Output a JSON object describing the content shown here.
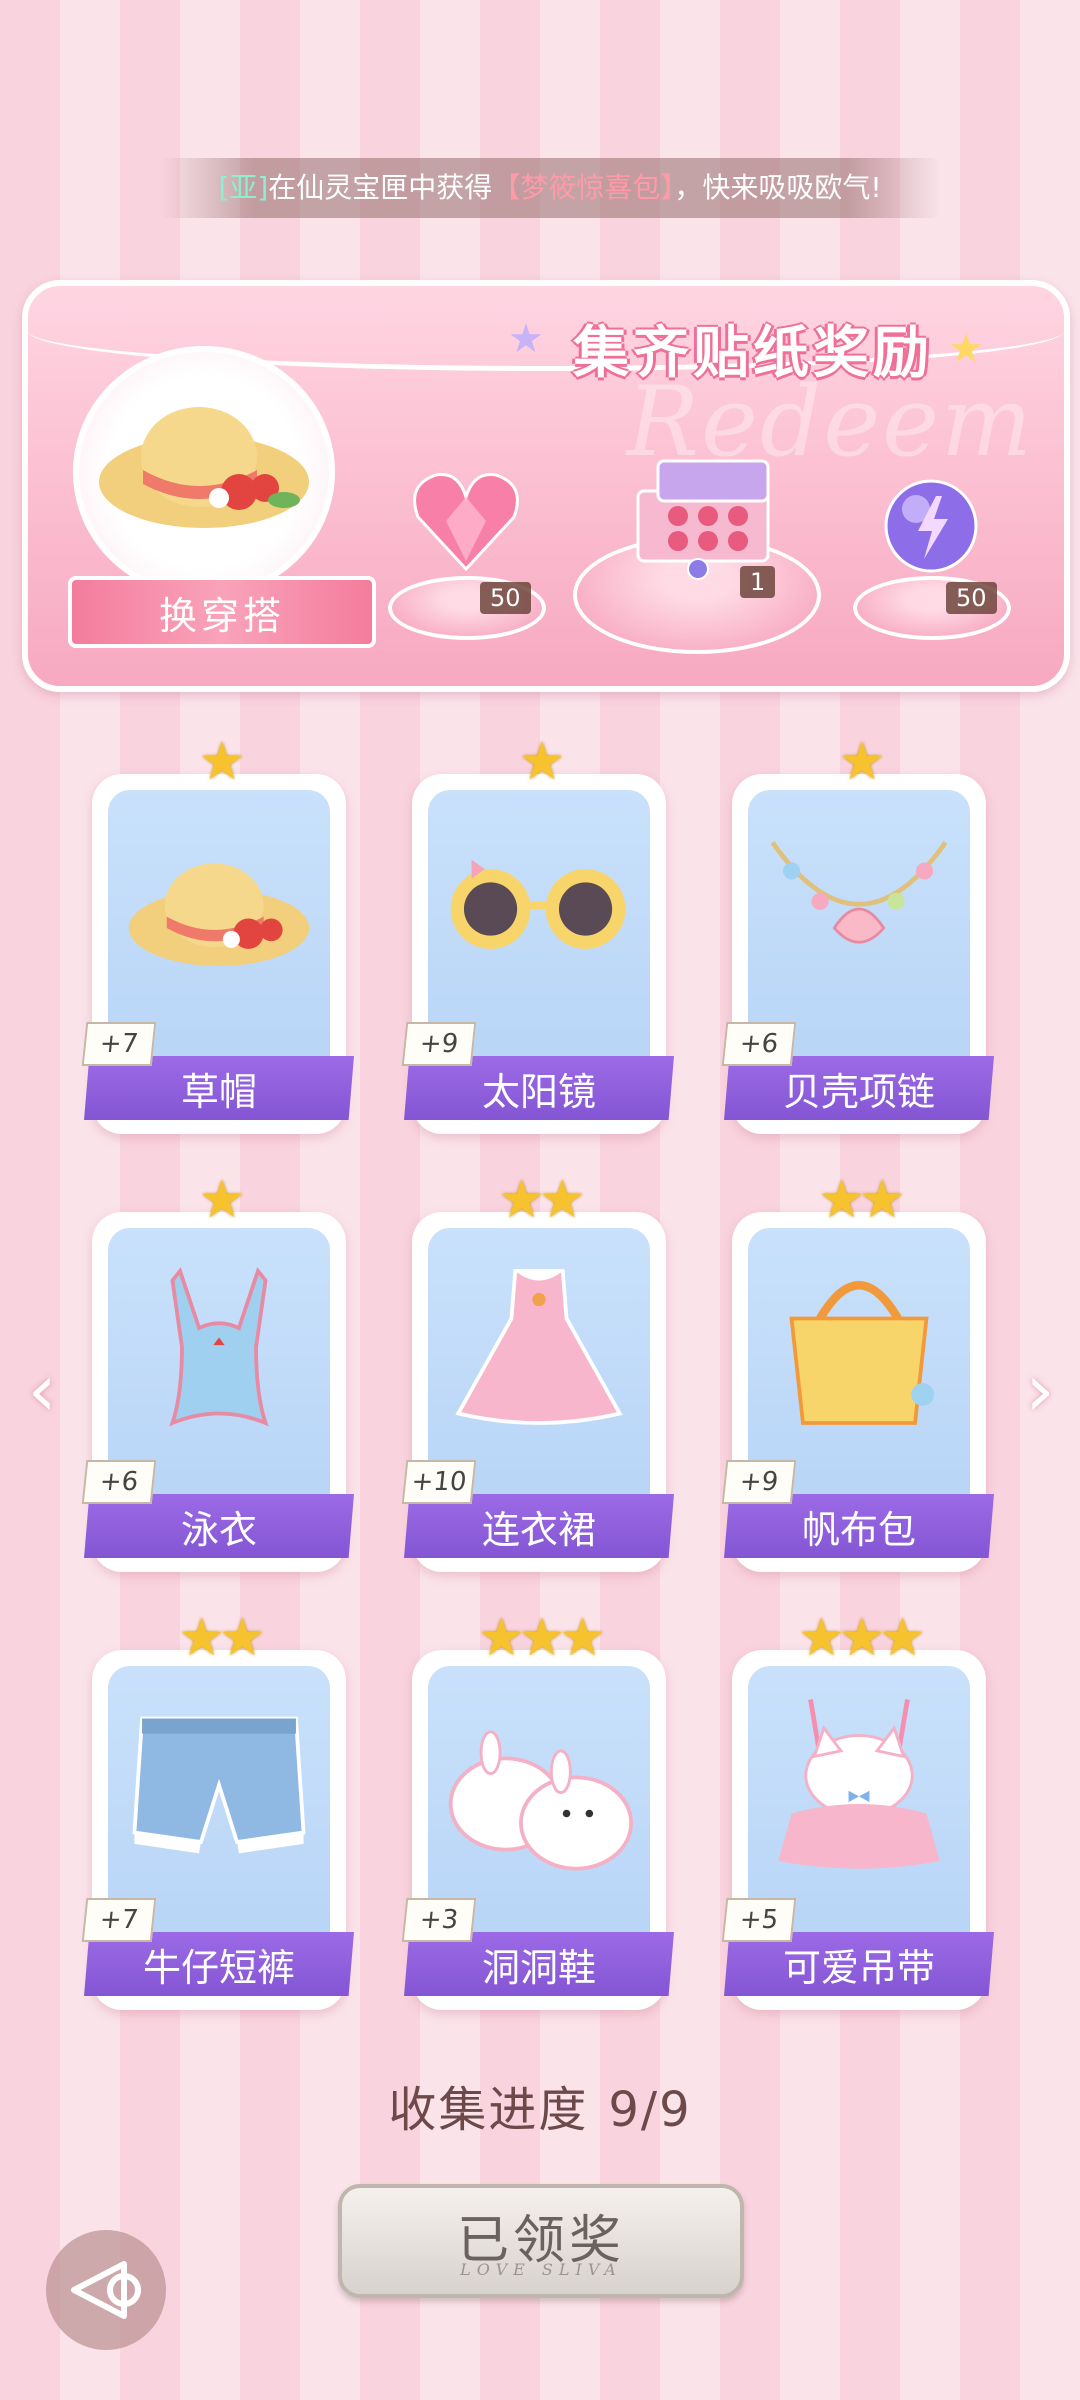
{
  "ticker": {
    "player": "[亚]",
    "text_before": "在仙灵宝匣中获得",
    "item": "【梦筱惊喜包】",
    "text_after": "，快来吸吸欧气!"
  },
  "banner": {
    "title": "集齐贴纸奖励",
    "watermark": "Redeem",
    "swap_label": "换穿搭",
    "rewards": [
      {
        "icon": "pink-heart-gem-icon",
        "count": "50"
      },
      {
        "icon": "gift-box-icon",
        "count": "1"
      },
      {
        "icon": "purple-lightning-orb-icon",
        "count": "50"
      }
    ]
  },
  "items": [
    {
      "name": "草帽",
      "bonus": "+7",
      "stars": "★",
      "icon": "straw-hat-icon"
    },
    {
      "name": "太阳镜",
      "bonus": "+9",
      "stars": "★",
      "icon": "flower-sunglasses-icon"
    },
    {
      "name": "贝壳项链",
      "bonus": "+6",
      "stars": "★",
      "icon": "shell-necklace-icon"
    },
    {
      "name": "泳衣",
      "bonus": "+6",
      "stars": "★",
      "icon": "swimsuit-icon"
    },
    {
      "name": "连衣裙",
      "bonus": "+10",
      "stars": "★★",
      "icon": "dress-icon"
    },
    {
      "name": "帆布包",
      "bonus": "+9",
      "stars": "★★",
      "icon": "canvas-bag-icon"
    },
    {
      "name": "牛仔短裤",
      "bonus": "+7",
      "stars": "★★",
      "icon": "denim-shorts-icon"
    },
    {
      "name": "洞洞鞋",
      "bonus": "+3",
      "stars": "★★★",
      "icon": "bunny-clogs-icon"
    },
    {
      "name": "可爱吊带",
      "bonus": "+5",
      "stars": "★★★",
      "icon": "cat-camisole-icon"
    }
  ],
  "progress": {
    "label": "收集进度",
    "value": "9/9"
  },
  "claim_button": {
    "label": "已领奖",
    "sub": "LOVE SLIVA"
  },
  "nav": {
    "prev": "‹",
    "next": "›"
  },
  "colors": {
    "accent_purple": "#8a5bd8",
    "banner_pink": "#f7a9c1",
    "star_gold": "#f6c22d"
  }
}
